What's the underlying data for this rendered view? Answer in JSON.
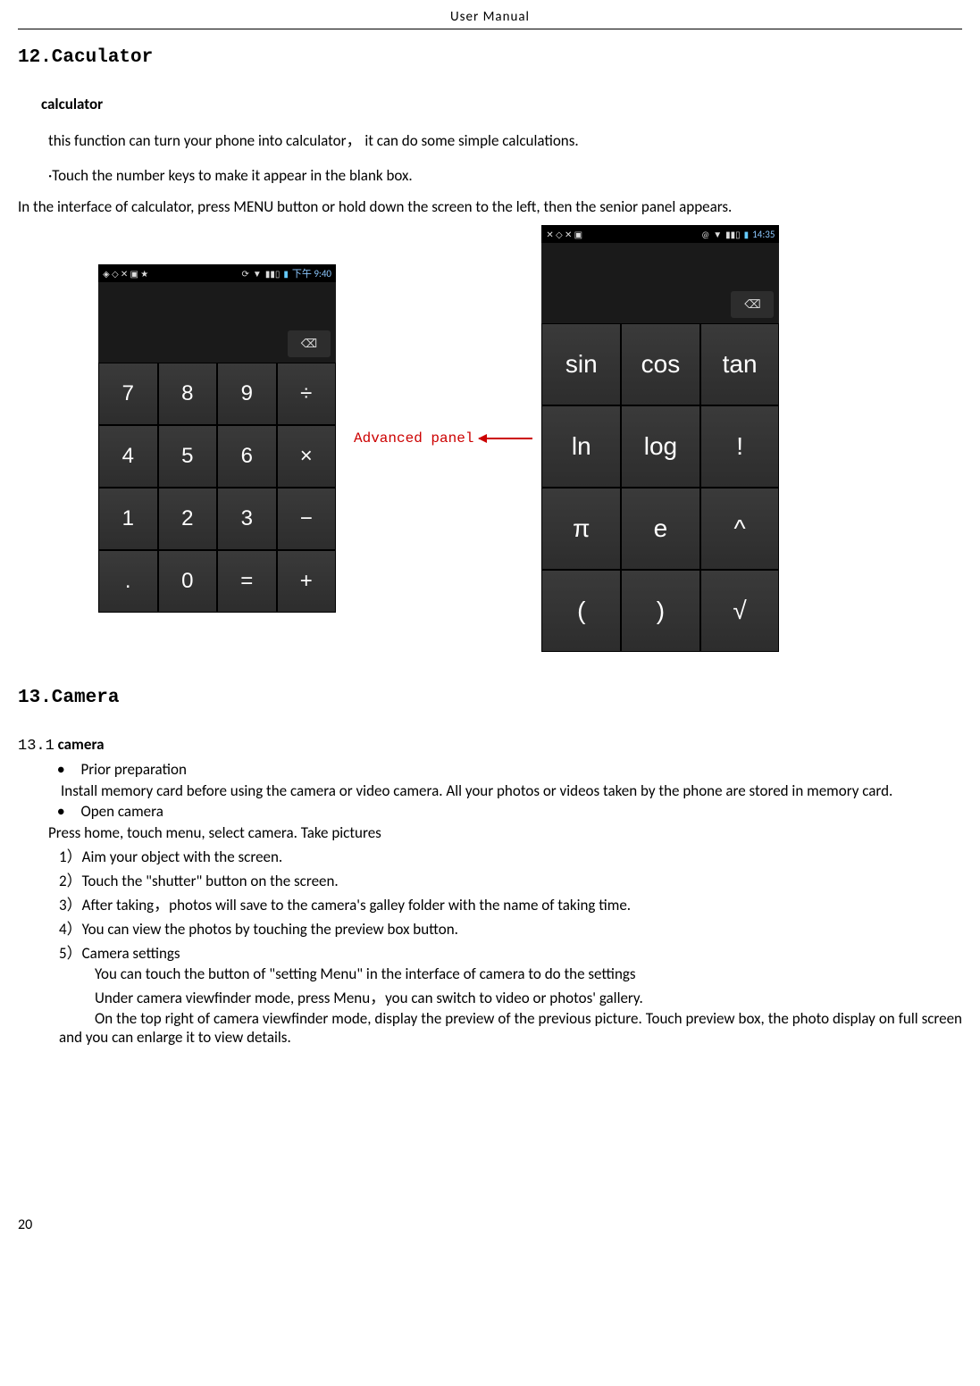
{
  "header": "User    Manual",
  "sec12": {
    "title": "12.Caculator",
    "sub": "calculator",
    "intro": "this function can turn your phone into calculator，  it can do some simple calculations.",
    "bullet": "·Touch the number keys to make it appear in the blank box.",
    "full": "In the interface of calculator, press MENU button or hold down the screen to the left, then the senior panel appears."
  },
  "screens": {
    "time1": "下午 9:40",
    "time2": "14:35",
    "backspace_glyph": "⌫",
    "basic_keys": [
      "7",
      "8",
      "9",
      "÷",
      "4",
      "5",
      "6",
      "×",
      "1",
      "2",
      "3",
      "−",
      ".",
      "0",
      "=",
      "+"
    ],
    "adv_keys": [
      "sin",
      "cos",
      "tan",
      "ln",
      "log",
      "!",
      "π",
      "e",
      "^",
      "(",
      ")",
      "√"
    ],
    "mid_label": "Advanced panel"
  },
  "sec13": {
    "title": "13.Camera",
    "sub_num": "13.1",
    "sub_bold": " camera",
    "b1": "Prior preparation",
    "b1_body": "Install memory card before using the camera or video camera. All your photos or videos taken by the phone are stored in memory card.",
    "b2": "Open camera",
    "b2_body": "Press home, touch menu, select camera. Take pictures",
    "n1": "1）Aim your object with the screen.",
    "n2": "2）Touch the \"shutter\" button on the screen.",
    "n3": "3）After taking，photos will save to the camera's galley folder with the name of taking time.",
    "n4": "4）You can view the photos by touching the preview box button.",
    "n5": "5）Camera settings",
    "s1": "You can touch the button of \"setting Menu\" in the interface of camera to do the settings",
    "s2": "Under camera viewfinder mode, press Menu，you can switch to video or photos' gallery.",
    "s3": "On the top right of camera viewfinder mode, display the preview of the previous picture. Touch preview box, the photo display on full screen and you can enlarge it to view details."
  },
  "page": "20"
}
